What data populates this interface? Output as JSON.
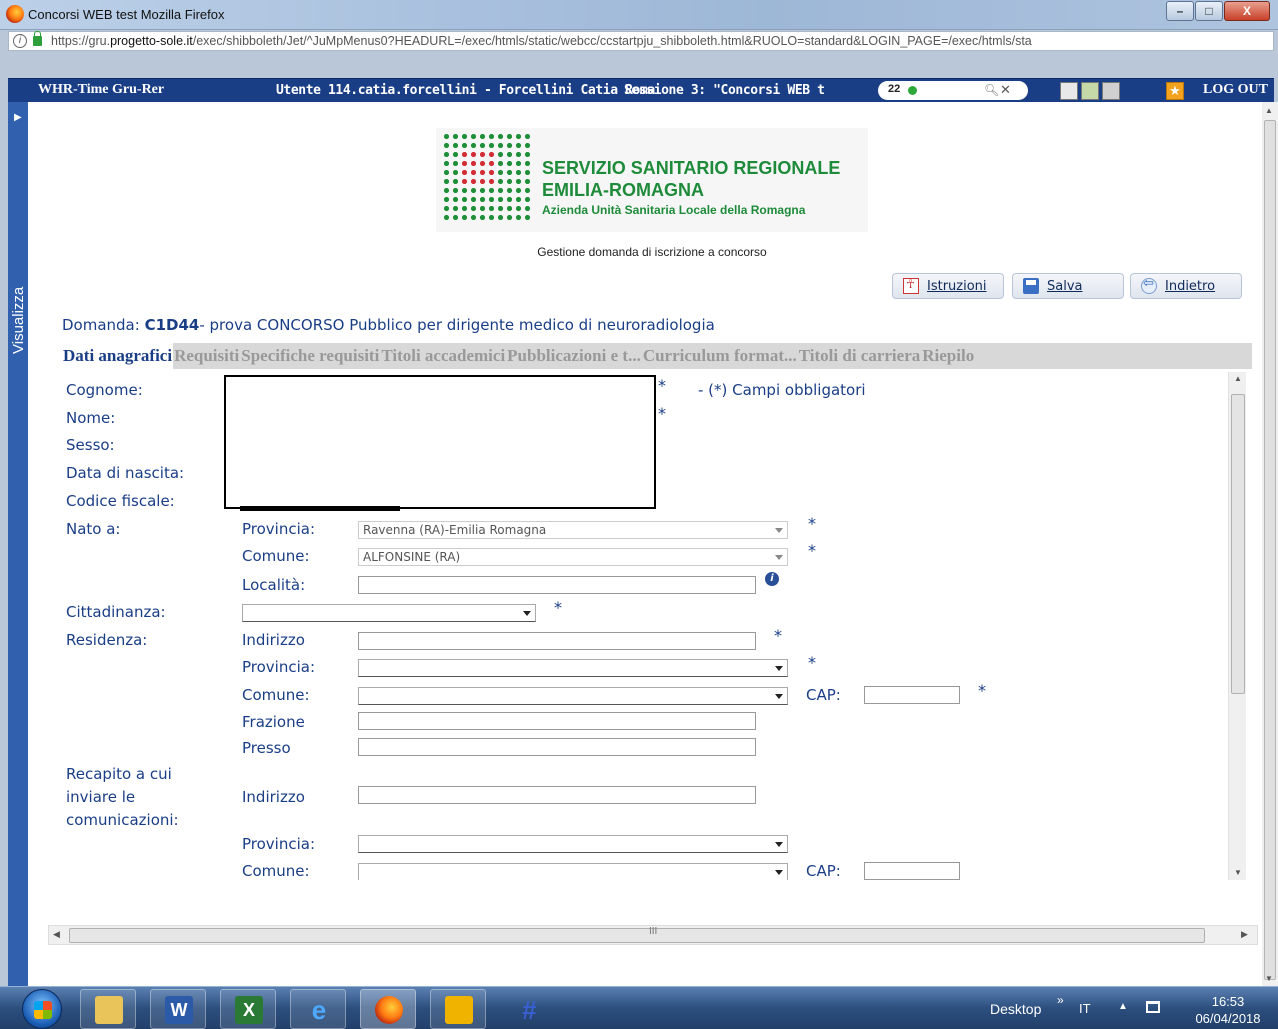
{
  "window": {
    "title": "Concorsi WEB test   Mozilla Firefox",
    "minimize": "–",
    "maximize": "□",
    "close": "X"
  },
  "urlbar": {
    "url_prefix": "https://gru.",
    "url_domain": "progetto-sole.it",
    "url_rest": "/exec/shibboleth/Jet/^JuMpMenus0?HEADURL=/exec/htmls/static/webcc/ccstartpju_shibboleth.html&RUOLO=standard&LOGIN_PAGE=/exec/htmls/sta"
  },
  "appbar": {
    "app_name": "WHR-Time Gru-Rer",
    "user": "Utente 114.catia.forcellini - Forcellini Catia Roma",
    "session": "Sessione 3: \"Concorsi WEB t",
    "search_count": "22",
    "logout": "LOG OUT"
  },
  "sidebar": {
    "tab_label": "Visualizza",
    "arrow": "▶"
  },
  "logo": {
    "line1": "SERVIZIO SANITARIO REGIONALE",
    "line2": "EMILIA-ROMAGNA",
    "line3": "Azienda Unità Sanitaria Locale della Romagna"
  },
  "page": {
    "subtitle": "Gestione domanda di iscrizione a concorso",
    "buttons": {
      "istruzioni": "Istruzioni",
      "salva": "Salva",
      "indietro": "Indietro"
    },
    "domanda_label": "Domanda: ",
    "domanda_code": "C1D44",
    "domanda_desc": "- prova CONCORSO Pubblico per dirigente medico di neuroradiologia"
  },
  "tabs": [
    {
      "label": "Dati anagrafici",
      "active": true
    },
    {
      "label": "Requisiti",
      "active": false
    },
    {
      "label": "Specifiche requisiti",
      "active": false
    },
    {
      "label": "Titoli accademici",
      "active": false
    },
    {
      "label": "Pubblicazioni e t...",
      "active": false
    },
    {
      "label": "Curriculum format...",
      "active": false
    },
    {
      "label": "Titoli di carriera",
      "active": false
    },
    {
      "label": "Riepilo",
      "active": false
    }
  ],
  "form": {
    "required_note": "- (*) Campi obbligatori",
    "required_mark": "*",
    "labels": {
      "cognome": "Cognome:",
      "nome": "Nome:",
      "sesso": "Sesso:",
      "data_nascita": "Data di nascita:",
      "codice_fiscale": "Codice fiscale:",
      "nato_a": "Nato a:",
      "cittadinanza": "Cittadinanza:",
      "residenza": "Residenza:",
      "recapito_1": "Recapito a cui",
      "recapito_2": "inviare le",
      "recapito_3": "comunicazioni:"
    },
    "sub": {
      "provincia": "Provincia:",
      "comune": "Comune:",
      "localita": "Località:",
      "indirizzo": "Indirizzo",
      "frazione": "Frazione",
      "presso": "Presso",
      "cap": "CAP:"
    },
    "nato_provincia_value": "Ravenna (RA)-Emilia Romagna",
    "nato_comune_value": "ALFONSINE (RA)"
  },
  "taskbar": {
    "desktop": "Desktop",
    "chevron": "»",
    "lang": "IT",
    "time": "16:53",
    "date": "06/04/2018"
  }
}
